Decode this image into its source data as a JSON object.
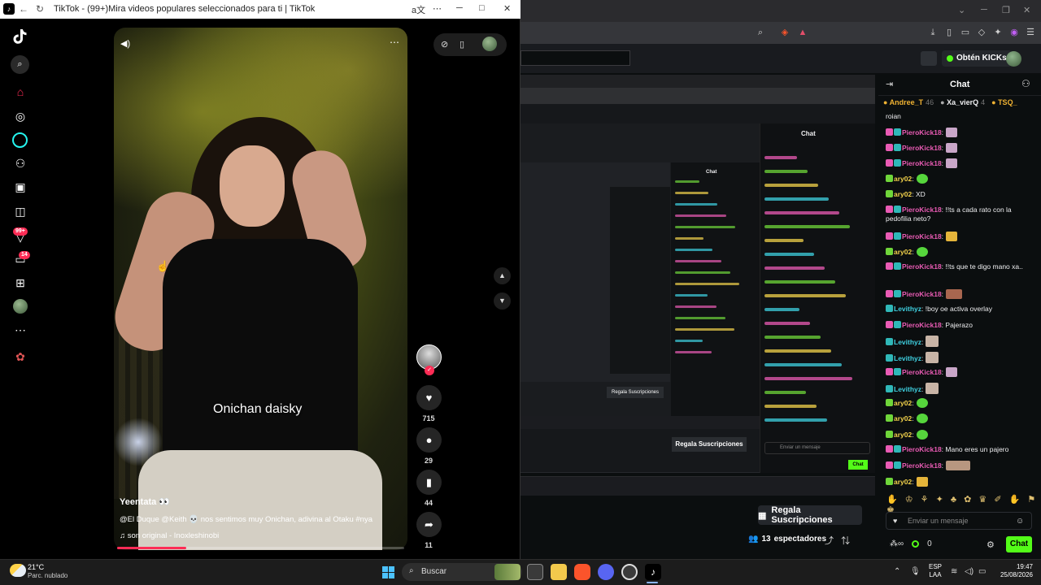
{
  "tiktok": {
    "window_title": "TikTok - (99+)Mira videos populares seleccionados para ti | TikTok",
    "sidebar": {
      "inbox_badge": "99+",
      "messages_badge": "14"
    },
    "video": {
      "caption": "Onichan daisky",
      "author": "Yeentata 👀",
      "description": "@El Duque @Keith 💀 nos sentimos muy Onichan, adivina al Otaku #nya",
      "sound": "son original - Inoxleshinobi",
      "progress": 0.24
    },
    "actions": {
      "likes": "715",
      "comments": "29",
      "saves": "44",
      "shares": "11"
    }
  },
  "kick": {
    "get_kicks_label": "Obtén KICKs",
    "chat": {
      "title": "Chat",
      "gifters": [
        {
          "name": "Andree_T",
          "count": "46"
        },
        {
          "name": "Xa_vierQ",
          "count": "4"
        },
        {
          "name": "TSQ_",
          "count": ""
        }
      ],
      "messages": [
        {
          "user": "",
          "text": "roian",
          "color": "plain",
          "emote": ""
        },
        {
          "user": "PieroKick18",
          "text": ":",
          "color": "pink",
          "emote": "cat"
        },
        {
          "user": "PieroKick18",
          "text": ":",
          "color": "pink",
          "emote": "cat"
        },
        {
          "user": "PieroKick18",
          "text": ":",
          "color": "pink",
          "emote": "cat"
        },
        {
          "user": "ary02",
          "text": ":",
          "color": "yellow",
          "emote": "frog"
        },
        {
          "user": "ary02",
          "text": ": XD",
          "color": "yellow",
          "emote": ""
        },
        {
          "user": "PieroKick18",
          "text": ": !!ts a cada rato con la pedofilia neto?",
          "color": "pink",
          "emote": ""
        },
        {
          "user": "PieroKick18",
          "text": ":",
          "color": "pink",
          "emote": "gold"
        },
        {
          "user": "ary02",
          "text": ":",
          "color": "yellow",
          "emote": "frog"
        },
        {
          "user": "PieroKick18",
          "text": ": !!ts que te digo mano xa..",
          "color": "pink",
          "emote": ""
        },
        {
          "user": "PieroKick18",
          "text": ":",
          "color": "pink",
          "emote": "pic"
        },
        {
          "user": "Levithyz",
          "text": ": !boy oe activa overlay",
          "color": "teal",
          "emote": ""
        },
        {
          "user": "PieroKick18",
          "text": ": Pajerazo",
          "color": "pink",
          "emote": ""
        },
        {
          "user": "Levithyz",
          "text": ":",
          "color": "teal",
          "emote": "pic2"
        },
        {
          "user": "Levithyz",
          "text": ":",
          "color": "teal",
          "emote": "pic2"
        },
        {
          "user": "PieroKick18",
          "text": ":",
          "color": "pink",
          "emote": "cat"
        },
        {
          "user": "Levithyz",
          "text": ":",
          "color": "teal",
          "emote": "pic2"
        },
        {
          "user": "ary02",
          "text": ":",
          "color": "yellow",
          "emote": "frog"
        },
        {
          "user": "ary02",
          "text": ":",
          "color": "yellow",
          "emote": "frog"
        },
        {
          "user": "ary02",
          "text": ":",
          "color": "yellow",
          "emote": "frog"
        },
        {
          "user": "PieroKick18",
          "text": ": Mano eres un pajero",
          "color": "pink",
          "emote": ""
        },
        {
          "user": "PieroKick18",
          "text": ":",
          "color": "pink",
          "emote": "arm"
        },
        {
          "user": "ary02",
          "text": ":",
          "color": "yellow",
          "emote": "gold"
        }
      ],
      "input_placeholder": "Enviar un mensaje",
      "points": "0",
      "send_label": "Chat"
    },
    "stream": {
      "subscribe_label": "Regala Suscripciones",
      "viewers_count": "13",
      "viewers_label": "espectadores"
    }
  },
  "taskbar": {
    "temperature": "21°C",
    "weather": "Parc. nublado",
    "search_label": "Buscar",
    "lang_top": "ESP",
    "lang_bottom": "LAA",
    "time": "19:47",
    "date": "25/08/2026"
  },
  "colors": {
    "tiktok_red": "#fe2c55",
    "tiktok_cyan": "#25f4ee",
    "kick_green": "#53fc18"
  }
}
